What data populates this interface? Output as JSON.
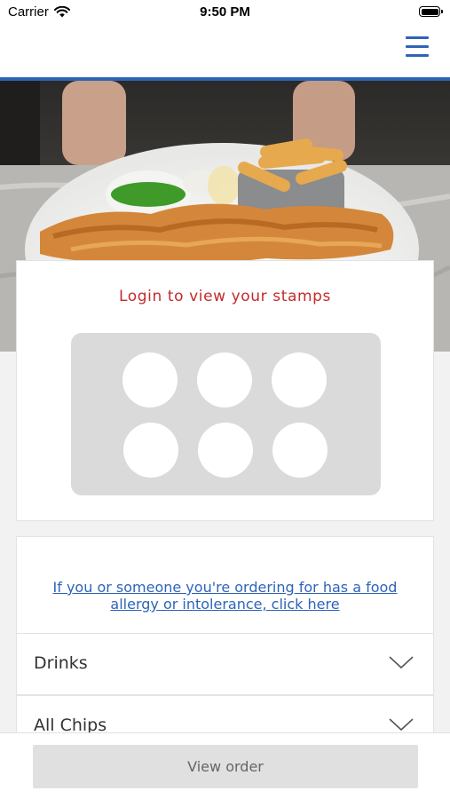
{
  "status_bar": {
    "carrier": "Carrier",
    "time": "9:50 PM"
  },
  "nav": {
    "menu_icon": "hamburger-menu-icon",
    "accent_color": "#2e64b8"
  },
  "stamp_card": {
    "login_text": "Login to view your stamps",
    "login_color": "#c32b2b",
    "stamp_count": 6,
    "stamps_filled": 0
  },
  "allergy": {
    "link_text": "If you or someone you're ordering for has a food allergy or intolerance, click here"
  },
  "menu_categories": [
    {
      "label": "Drinks",
      "icon": "chevron-down-icon"
    },
    {
      "label": "All Chips",
      "icon": "chevron-down-icon"
    }
  ],
  "footer": {
    "view_order_label": "View order"
  }
}
